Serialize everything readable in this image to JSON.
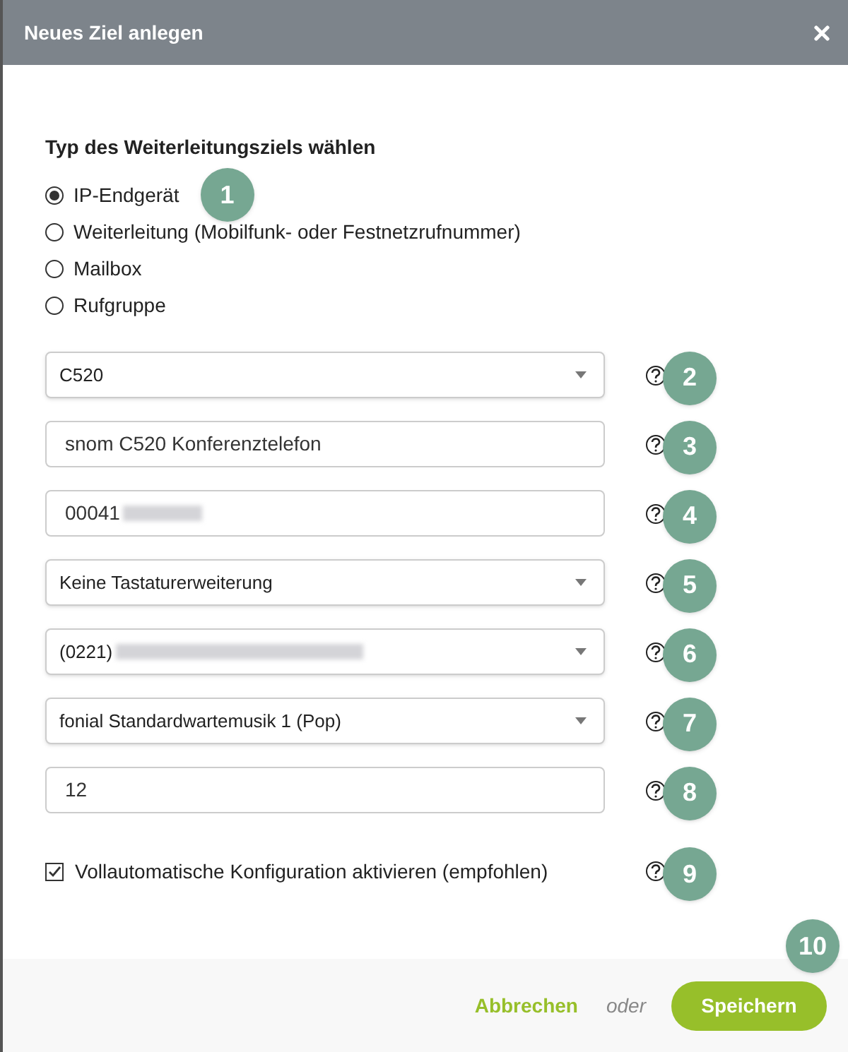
{
  "dialog": {
    "title": "Neues Ziel anlegen"
  },
  "type_section": {
    "heading": "Typ des Weiterleitungsziels wählen",
    "badge": "1",
    "options": [
      {
        "label": "IP-Endgerät",
        "selected": true
      },
      {
        "label": "Weiterleitung (Mobilfunk- oder Festnetzrufnummer)",
        "selected": false
      },
      {
        "label": "Mailbox",
        "selected": false
      },
      {
        "label": "Rufgruppe",
        "selected": false
      }
    ]
  },
  "fields": [
    {
      "kind": "select",
      "value": "C520",
      "badge": "2",
      "redacted": false
    },
    {
      "kind": "input",
      "value": "snom C520 Konferenztelefon",
      "badge": "3",
      "redacted": false
    },
    {
      "kind": "input",
      "value": "00041",
      "badge": "4",
      "redacted": true
    },
    {
      "kind": "select",
      "value": "Keine Tastaturerweiterung",
      "badge": "5",
      "redacted": false
    },
    {
      "kind": "select",
      "value": "(0221)",
      "badge": "6",
      "redacted": true
    },
    {
      "kind": "select",
      "value": "fonial Standardwartemusik 1 (Pop)",
      "badge": "7",
      "redacted": false
    },
    {
      "kind": "input",
      "value": "12",
      "badge": "8",
      "redacted": false
    }
  ],
  "auto_config": {
    "label": "Vollautomatische Konfiguration aktivieren (empfohlen)",
    "checked": true,
    "badge": "9"
  },
  "footer": {
    "cancel": "Abbrechen",
    "separator": "oder",
    "save": "Speichern",
    "badge": "10"
  }
}
